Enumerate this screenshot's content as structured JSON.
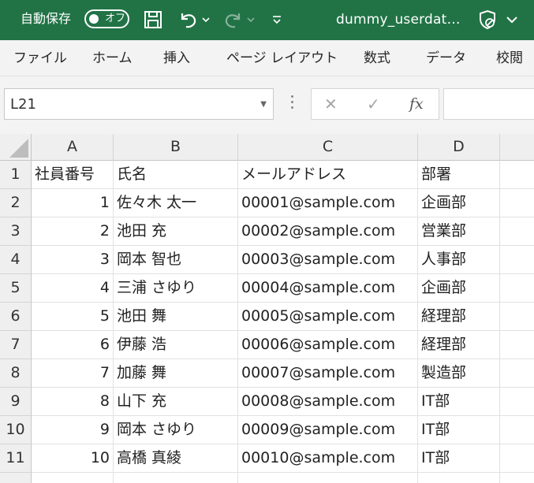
{
  "titlebar": {
    "autosave_label": "自動保存",
    "autosave_state": "オフ",
    "document_title": "dummy_userdat…",
    "icons": [
      "save-icon",
      "undo-icon",
      "redo-icon",
      "customize-qat-icon",
      "sensitivity-icon",
      "chevron-down-icon"
    ]
  },
  "ribbon": {
    "tabs": [
      "ファイル",
      "ホーム",
      "挿入",
      "ページ レイアウト",
      "数式",
      "データ",
      "校閲"
    ]
  },
  "formula_bar": {
    "name_box": "L21",
    "cancel_symbol": "✕",
    "enter_symbol": "✓",
    "fx_symbol": "fx",
    "formula": ""
  },
  "sheet": {
    "columns": [
      "A",
      "B",
      "C",
      "D"
    ],
    "rows": [
      {
        "row": "1",
        "a": "社員番号",
        "b": "氏名",
        "c": "メールアドレス",
        "d": "部署"
      },
      {
        "row": "2",
        "a": "1",
        "b": "佐々木 太一",
        "c": "00001@sample.com",
        "d": "企画部"
      },
      {
        "row": "3",
        "a": "2",
        "b": "池田 充",
        "c": "00002@sample.com",
        "d": "営業部"
      },
      {
        "row": "4",
        "a": "3",
        "b": "岡本 智也",
        "c": "00003@sample.com",
        "d": "人事部"
      },
      {
        "row": "5",
        "a": "4",
        "b": "三浦 さゆり",
        "c": "00004@sample.com",
        "d": "企画部"
      },
      {
        "row": "6",
        "a": "5",
        "b": "池田 舞",
        "c": "00005@sample.com",
        "d": "経理部"
      },
      {
        "row": "7",
        "a": "6",
        "b": "伊藤 浩",
        "c": "00006@sample.com",
        "d": "経理部"
      },
      {
        "row": "8",
        "a": "7",
        "b": "加藤 舞",
        "c": "00007@sample.com",
        "d": "製造部"
      },
      {
        "row": "9",
        "a": "8",
        "b": "山下 充",
        "c": "00008@sample.com",
        "d": "IT部"
      },
      {
        "row": "10",
        "a": "9",
        "b": "岡本 さゆり",
        "c": "00009@sample.com",
        "d": "IT部"
      },
      {
        "row": "11",
        "a": "10",
        "b": "高橋 真綾",
        "c": "00010@sample.com",
        "d": "IT部"
      }
    ]
  },
  "colors": {
    "titlebar_bg": "#217346",
    "ribbon_bg": "#f3f3f3",
    "header_bg": "#efefef"
  }
}
